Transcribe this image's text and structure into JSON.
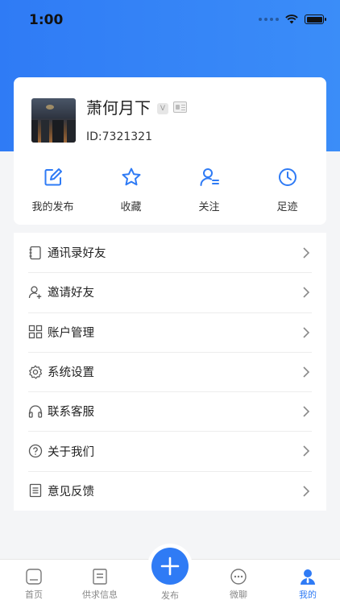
{
  "status_bar": {
    "time": "1:00"
  },
  "profile": {
    "name": "萧何月下",
    "verified_badge": "V",
    "user_id": "ID:7321321"
  },
  "quick_actions": [
    {
      "label": "我的发布",
      "icon": "edit-icon"
    },
    {
      "label": "收藏",
      "icon": "star-icon"
    },
    {
      "label": "关注",
      "icon": "user-follow-icon"
    },
    {
      "label": "足迹",
      "icon": "clock-icon"
    }
  ],
  "menu": [
    {
      "label": "通讯录好友",
      "icon": "contacts-book-icon"
    },
    {
      "label": "邀请好友",
      "icon": "add-user-icon"
    },
    {
      "label": "账户管理",
      "icon": "grid-icon"
    },
    {
      "label": "系统设置",
      "icon": "gear-icon"
    },
    {
      "label": "联系客服",
      "icon": "headset-icon"
    },
    {
      "label": "关于我们",
      "icon": "question-icon"
    },
    {
      "label": "意见反馈",
      "icon": "document-icon"
    }
  ],
  "tabbar": {
    "tabs": [
      {
        "label": "首页",
        "icon": "home-icon"
      },
      {
        "label": "供求信息",
        "icon": "list-doc-icon"
      },
      {
        "label": "发布",
        "icon": "plus-icon"
      },
      {
        "label": "微聊",
        "icon": "chat-icon"
      },
      {
        "label": "我的",
        "icon": "person-icon",
        "active": true
      }
    ]
  },
  "colors": {
    "accent": "#2f7bf5",
    "background": "#f4f5f7"
  }
}
